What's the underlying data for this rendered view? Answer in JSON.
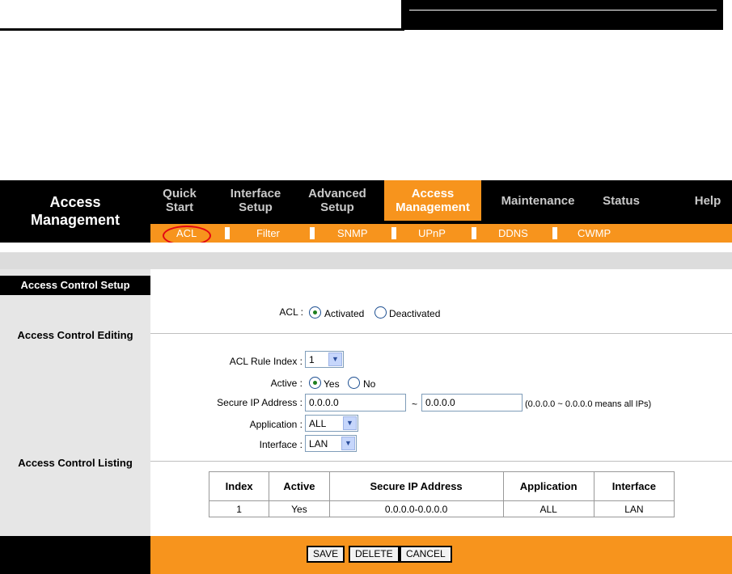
{
  "page_title": {
    "line1": "Access",
    "line2": "Management"
  },
  "nav": [
    {
      "label": "Quick Start"
    },
    {
      "label": "Interface Setup"
    },
    {
      "label": "Advanced Setup"
    },
    {
      "label": "Access Management"
    },
    {
      "label": "Maintenance"
    },
    {
      "label": "Status"
    },
    {
      "label": "Help"
    }
  ],
  "subnav": [
    {
      "label": "ACL"
    },
    {
      "label": "Filter"
    },
    {
      "label": "SNMP"
    },
    {
      "label": "UPnP"
    },
    {
      "label": "DDNS"
    },
    {
      "label": "CWMP"
    }
  ],
  "sidebar": {
    "setup": "Access Control Setup",
    "editing": "Access Control Editing",
    "listing": "Access Control Listing"
  },
  "acl": {
    "label": "ACL :",
    "activated": "Activated",
    "deactivated": "Deactivated",
    "selected": "Activated"
  },
  "editing": {
    "rule_index_label": "ACL Rule Index :",
    "rule_index_value": "1",
    "active_label": "Active :",
    "active_yes": "Yes",
    "active_no": "No",
    "active_selected": "Yes",
    "secure_ip_label": "Secure IP Address :",
    "ip_start": "0.0.0.0",
    "ip_separator": "~",
    "ip_end": "0.0.0.0",
    "ip_hint": "(0.0.0.0 ~ 0.0.0.0 means all IPs)",
    "application_label": "Application :",
    "application_value": "ALL",
    "interface_label": "Interface :",
    "interface_value": "LAN"
  },
  "listing": {
    "headers": [
      "Index",
      "Active",
      "Secure IP Address",
      "Application",
      "Interface"
    ],
    "rows": [
      [
        "1",
        "Yes",
        "0.0.0.0-0.0.0.0",
        "ALL",
        "LAN"
      ]
    ]
  },
  "buttons": {
    "save": "SAVE",
    "delete": "DELETE",
    "cancel": "CANCEL"
  },
  "colors": {
    "accent": "#f7941d",
    "highlight_circle": "#e30613"
  }
}
